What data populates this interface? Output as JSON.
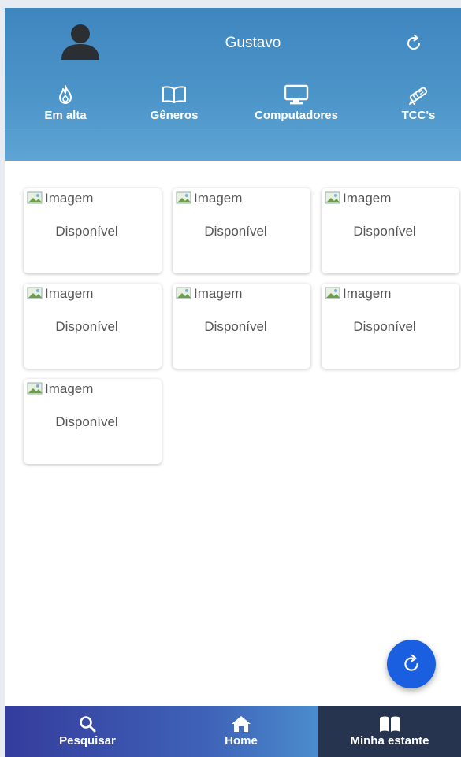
{
  "header": {
    "username": "Gustavo",
    "tabs": [
      {
        "label": "Em alta",
        "icon": "flame-icon"
      },
      {
        "label": "Gêneros",
        "icon": "open-book-icon"
      },
      {
        "label": "Computadores",
        "icon": "monitor-icon"
      },
      {
        "label": "TCC's",
        "icon": "diploma-icon"
      }
    ]
  },
  "books": [
    {
      "image_alt": "Imagem",
      "status": "Disponível"
    },
    {
      "image_alt": "Imagem",
      "status": "Disponível"
    },
    {
      "image_alt": "Imagem",
      "status": "Disponível"
    },
    {
      "image_alt": "Imagem",
      "status": "Disponível"
    },
    {
      "image_alt": "Imagem",
      "status": "Disponível"
    },
    {
      "image_alt": "Imagem",
      "status": "Disponível"
    },
    {
      "image_alt": "Imagem",
      "status": "Disponível"
    }
  ],
  "bottom_nav": {
    "items": [
      {
        "label": "Pesquisar",
        "icon": "search-icon"
      },
      {
        "label": "Home",
        "icon": "home-icon"
      },
      {
        "label": "Minha estante",
        "icon": "bookshelf-icon",
        "active": true
      }
    ]
  },
  "colors": {
    "header": "#4b94c8",
    "fab": "#1a5fe0",
    "bottom_active": "#26344f"
  }
}
